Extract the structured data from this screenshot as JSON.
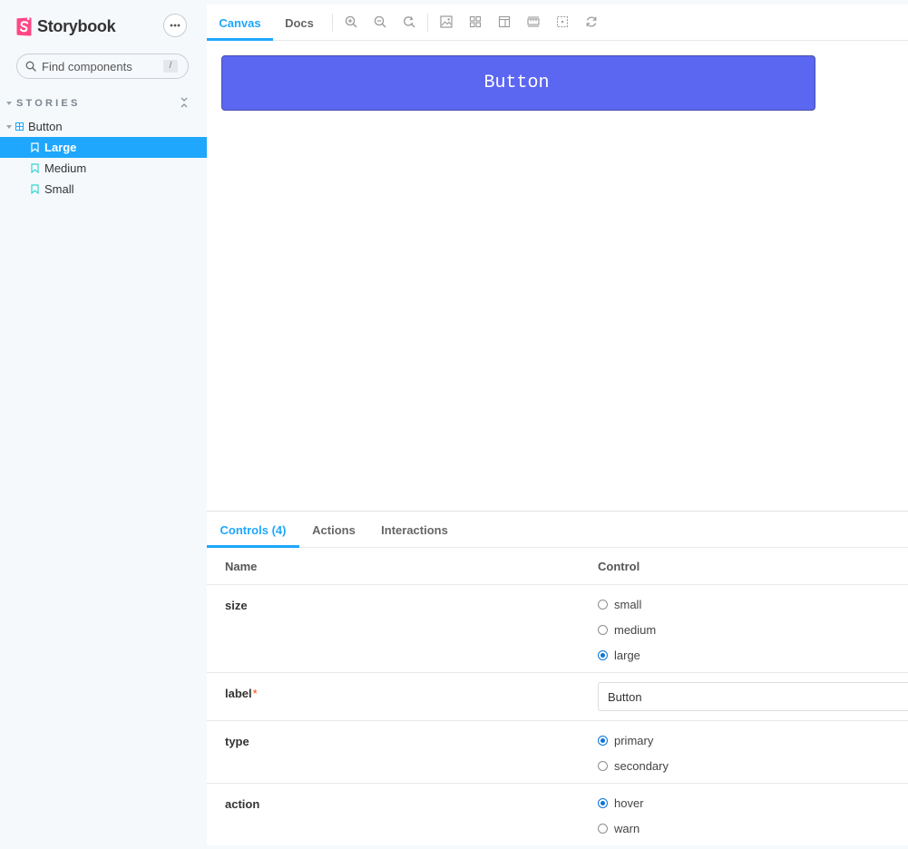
{
  "brand": {
    "name": "Storybook",
    "accent": "#ff4785"
  },
  "sidebar": {
    "search_placeholder": "Find components",
    "search_shortcut": "/",
    "section_title": "STORIES",
    "component": "Button",
    "stories": [
      {
        "label": "Large",
        "selected": true
      },
      {
        "label": "Medium",
        "selected": false
      },
      {
        "label": "Small",
        "selected": false
      }
    ]
  },
  "toolbar": {
    "tabs": [
      "Canvas",
      "Docs"
    ],
    "active_tab": "Canvas",
    "icons": [
      "zoom-in-icon",
      "zoom-out-icon",
      "zoom-reset-icon",
      "background-icon",
      "grid-icon",
      "viewport-icon",
      "measure-icon",
      "outline-icon",
      "remount-icon"
    ]
  },
  "preview": {
    "button_label": "Button",
    "button_color": "#5b66f1"
  },
  "addons": {
    "tabs": [
      "Controls (4)",
      "Actions",
      "Interactions"
    ],
    "active_tab": "Controls (4)",
    "columns": {
      "name": "Name",
      "control": "Control"
    },
    "rows": {
      "size": {
        "name": "size",
        "options": [
          "small",
          "medium",
          "large"
        ],
        "selected": "large"
      },
      "label": {
        "name": "label",
        "required_mark": "*",
        "value": "Button"
      },
      "type": {
        "name": "type",
        "options": [
          "primary",
          "secondary"
        ],
        "selected": "primary"
      },
      "action": {
        "name": "action",
        "options": [
          "hover",
          "warn"
        ],
        "selected": "hover"
      }
    }
  },
  "colors": {
    "accent": "#1ea7fd",
    "radio_checked": "#0b75d8",
    "sidebar_bg": "#f6f9fc"
  }
}
